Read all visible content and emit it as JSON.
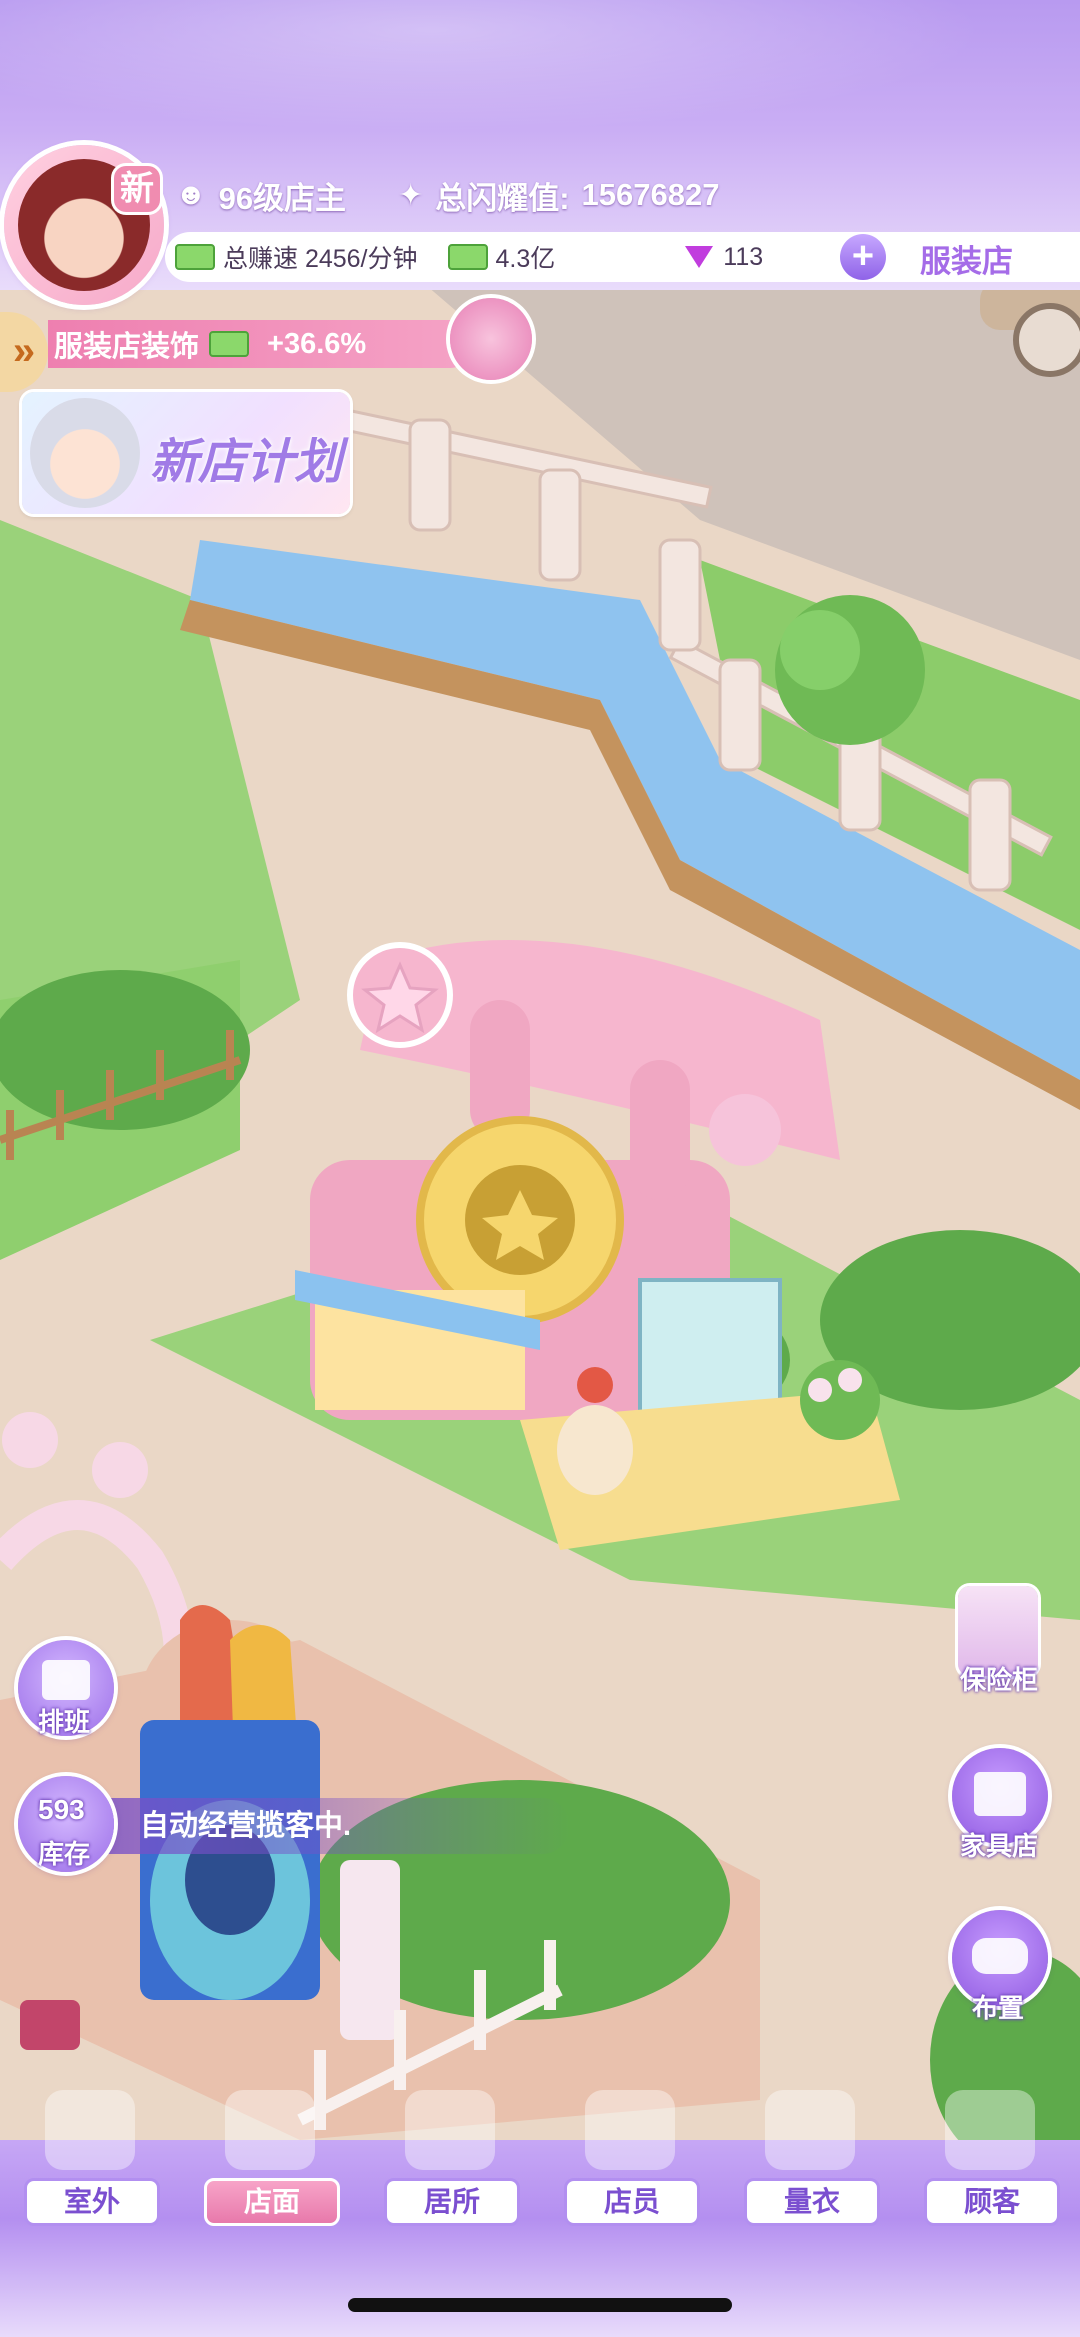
{
  "header": {
    "new_badge": "新",
    "level_text": "96级店主",
    "shine_label": "总闪耀值:",
    "shine_value": "15676827",
    "earn_speed": "总赚速 2456/分钟",
    "cash": "4.3亿",
    "gems": "113",
    "shop_name": "服装店"
  },
  "buff": {
    "arrow": "»",
    "label": "服装店装饰",
    "value": "+36.6%"
  },
  "new_shop_plan": {
    "label": "新店计划"
  },
  "left_buttons": {
    "schedule": "排班",
    "stock_count": "593",
    "stock_label": "库存",
    "status_text": "自动经营揽客中."
  },
  "right_buttons": {
    "safe": "保险柜",
    "furniture_store": "家具店",
    "arrange": "布置"
  },
  "bottom_nav": [
    {
      "label": "室外"
    },
    {
      "label": "店面"
    },
    {
      "label": "居所"
    },
    {
      "label": "店员"
    },
    {
      "label": "量衣"
    },
    {
      "label": "顾客"
    }
  ],
  "colors": {
    "accent": "#a56ce8",
    "pink": "#ee7fb0",
    "gem": "#c13dde",
    "grass": "#8fcf6e",
    "water": "#8fc3ef"
  }
}
